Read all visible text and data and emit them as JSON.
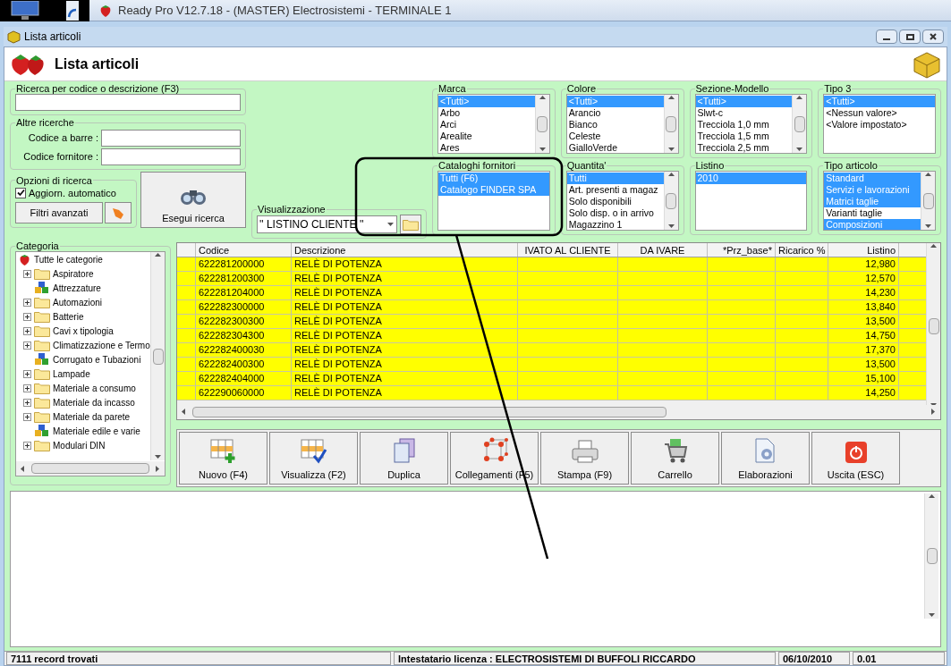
{
  "taskbar": {
    "title": "Ready Pro V12.7.18 - (MASTER) Electrosistemi - TERMINALE 1"
  },
  "window": {
    "title": "Lista articoli",
    "heading": "Lista articoli"
  },
  "search": {
    "title": "Ricerca per codice o descrizione (F3)"
  },
  "other_searches": {
    "title": "Altre ricerche",
    "fields": [
      {
        "label": "Codice a barre :"
      },
      {
        "label": "Codice fornitore :"
      }
    ]
  },
  "search_options": {
    "title": "Opzioni di ricerca",
    "auto_update": {
      "label": "Aggiorn. automatico",
      "checked": true
    },
    "advanced_filters": "Filtri avanzati"
  },
  "run_search": "Esegui ricerca",
  "view": {
    "title": "Visualizzazione",
    "value": "'' LISTINO CLIENTE ''"
  },
  "filters": [
    {
      "title": "Marca",
      "items": [
        {
          "text": "<Tutti>",
          "selected": true
        },
        {
          "text": "Arbo",
          "selected": false
        },
        {
          "text": "Arci",
          "selected": false
        },
        {
          "text": "Arealite",
          "selected": false
        },
        {
          "text": "Ares",
          "selected": false
        }
      ]
    },
    {
      "title": "Colore",
      "items": [
        {
          "text": "<Tutti>",
          "selected": true
        },
        {
          "text": "Arancio",
          "selected": false
        },
        {
          "text": "Bianco",
          "selected": false
        },
        {
          "text": "Celeste",
          "selected": false
        },
        {
          "text": "GialloVerde",
          "selected": false
        }
      ]
    },
    {
      "title": "Sezione-Modello",
      "items": [
        {
          "text": "<Tutti>",
          "selected": true
        },
        {
          "text": "Slwt-c",
          "selected": false
        },
        {
          "text": "Trecciola 1,0 mm",
          "selected": false
        },
        {
          "text": "Trecciola 1,5 mm",
          "selected": false
        },
        {
          "text": "Trecciola 2,5 mm",
          "selected": false
        }
      ]
    },
    {
      "title": "Tipo 3",
      "items": [
        {
          "text": "<Tutti>",
          "selected": true
        },
        {
          "text": "<Nessun valore>",
          "selected": false
        },
        {
          "text": "<Valore impostato>",
          "selected": false
        }
      ]
    },
    {
      "title": "Cataloghi fornitori",
      "items": [
        {
          "text": "Tutti (F6)",
          "selected": true
        },
        {
          "text": "Catalogo FINDER SPA",
          "selected": true
        }
      ]
    },
    {
      "title": "Quantita'",
      "items": [
        {
          "text": "Tutti",
          "selected": true
        },
        {
          "text": "Art. presenti a magaz",
          "selected": false
        },
        {
          "text": "Solo disponibili",
          "selected": false
        },
        {
          "text": "Solo disp. o in arrivo",
          "selected": false
        },
        {
          "text": "Magazzino 1",
          "selected": false
        }
      ]
    },
    {
      "title": "Listino",
      "items": [
        {
          "text": "2010",
          "selected": true
        }
      ]
    },
    {
      "title": "Tipo articolo",
      "items": [
        {
          "text": "Standard",
          "selected": true
        },
        {
          "text": "Servizi e lavorazioni",
          "selected": true
        },
        {
          "text": "Matrici taglie",
          "selected": true
        },
        {
          "text": "Varianti taglie",
          "selected": false
        },
        {
          "text": "Composizioni",
          "selected": true
        }
      ]
    }
  ],
  "categories": {
    "title": "Categoria",
    "tree": [
      {
        "label": "Tutte le categorie",
        "kind": "root",
        "children": [
          {
            "label": "Aspiratore",
            "kind": "folder"
          },
          {
            "label": "Attrezzature",
            "kind": "group"
          },
          {
            "label": "Automazioni",
            "kind": "folder"
          },
          {
            "label": "Batterie",
            "kind": "folder"
          },
          {
            "label": "Cavi x tipologia",
            "kind": "folder"
          },
          {
            "label": "Climatizzazione e Termo",
            "kind": "folder"
          },
          {
            "label": "Corrugato e Tubazioni",
            "kind": "group"
          },
          {
            "label": "Lampade",
            "kind": "folder"
          },
          {
            "label": "Materiale a consumo",
            "kind": "folder"
          },
          {
            "label": "Materiale da incasso",
            "kind": "folder"
          },
          {
            "label": "Materiale da parete",
            "kind": "folder"
          },
          {
            "label": "Materiale edile e varie",
            "kind": "group"
          },
          {
            "label": "Modulari DIN",
            "kind": "folder"
          }
        ]
      }
    ]
  },
  "table": {
    "columns": [
      "Codice",
      "Descrizione",
      "IVATO AL CLIENTE",
      "DA IVARE",
      "*Prz_base*",
      "Ricarico %",
      "Listino"
    ],
    "rows": [
      {
        "codice": "622281200000",
        "descrizione": "RELÈ DI POTENZA",
        "listino": "12,980"
      },
      {
        "codice": "622281200300",
        "descrizione": "RELÈ DI POTENZA",
        "listino": "12,570"
      },
      {
        "codice": "622281204000",
        "descrizione": "RELÈ DI POTENZA",
        "listino": "14,230"
      },
      {
        "codice": "622282300000",
        "descrizione": "RELÈ DI POTENZA",
        "listino": "13,840"
      },
      {
        "codice": "622282300300",
        "descrizione": "RELÈ DI POTENZA",
        "listino": "13,500"
      },
      {
        "codice": "622282304300",
        "descrizione": "RELÈ DI POTENZA",
        "listino": "14,750"
      },
      {
        "codice": "622282400030",
        "descrizione": "RELÈ DI POTENZA",
        "listino": "17,370"
      },
      {
        "codice": "622282400300",
        "descrizione": "RELÈ DI POTENZA",
        "listino": "13,500"
      },
      {
        "codice": "622282404000",
        "descrizione": "RELÈ DI POTENZA",
        "listino": "15,100"
      },
      {
        "codice": "622290060000",
        "descrizione": "RELÈ DI POTENZA",
        "listino": "14,250"
      }
    ]
  },
  "toolbar": [
    {
      "label": "Nuovo (F4)"
    },
    {
      "label": "Visualizza (F2)"
    },
    {
      "label": "Duplica"
    },
    {
      "label": "Collegamenti (F5)"
    },
    {
      "label": "Stampa (F9)"
    },
    {
      "label": "Carrello"
    },
    {
      "label": "Elaborazioni"
    },
    {
      "label": "Uscita (ESC)"
    }
  ],
  "status_bar": [
    "7111 record trovati",
    "Intestatario licenza : ELECTROSISTEMI DI BUFFOLI RICCARDO",
    "06/10/2010",
    "0.01"
  ]
}
